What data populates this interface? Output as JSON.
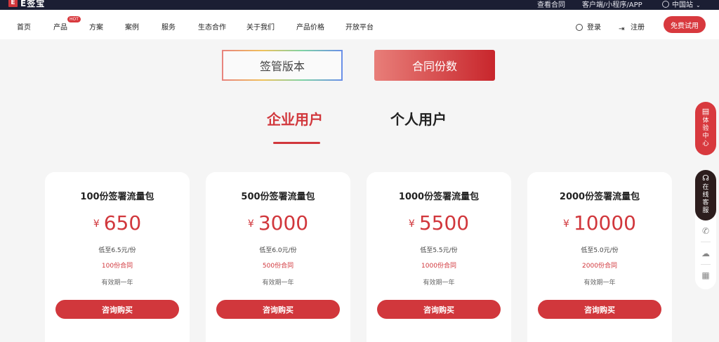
{
  "topbar": {
    "brand": "E签宝",
    "logo_letter": "E",
    "links": [
      "查看合同",
      "客户端/小程序/APP",
      "中国站"
    ]
  },
  "nav": {
    "items": [
      "首页",
      "产品",
      "方案",
      "案例",
      "服务",
      "生态合作",
      "关于我们",
      "产品价格",
      "开放平台"
    ],
    "hot_badge": "HOT",
    "login": "登录",
    "register": "注册",
    "trial": "免费试用"
  },
  "selector": {
    "version": "签管版本",
    "quantity": "合同份数"
  },
  "tabs": {
    "enterprise": "企业用户",
    "personal": "个人用户"
  },
  "cards": [
    {
      "title": "100份签署流量包",
      "currency": "¥",
      "price": "650",
      "unit_price": "低至6.5元/份",
      "copies": "100份合同",
      "validity": "有效期一年",
      "button": "咨询购买"
    },
    {
      "title": "500份签署流量包",
      "currency": "¥",
      "price": "3000",
      "unit_price": "低至6.0元/份",
      "copies": "500份合同",
      "validity": "有效期一年",
      "button": "咨询购买"
    },
    {
      "title": "1000份签署流量包",
      "currency": "¥",
      "price": "5500",
      "unit_price": "低至5.5元/份",
      "copies": "1000份合同",
      "validity": "有效期一年",
      "button": "咨询购买"
    },
    {
      "title": "2000份签署流量包",
      "currency": "¥",
      "price": "10000",
      "unit_price": "低至5.0元/份",
      "copies": "2000份合同",
      "validity": "有效期一年",
      "button": "咨询购买"
    }
  ],
  "sidebar": {
    "experience": "体验中心",
    "online_service": "在线客服"
  },
  "colors": {
    "accent": "#d1373c",
    "topbar": "#1b1e33"
  }
}
